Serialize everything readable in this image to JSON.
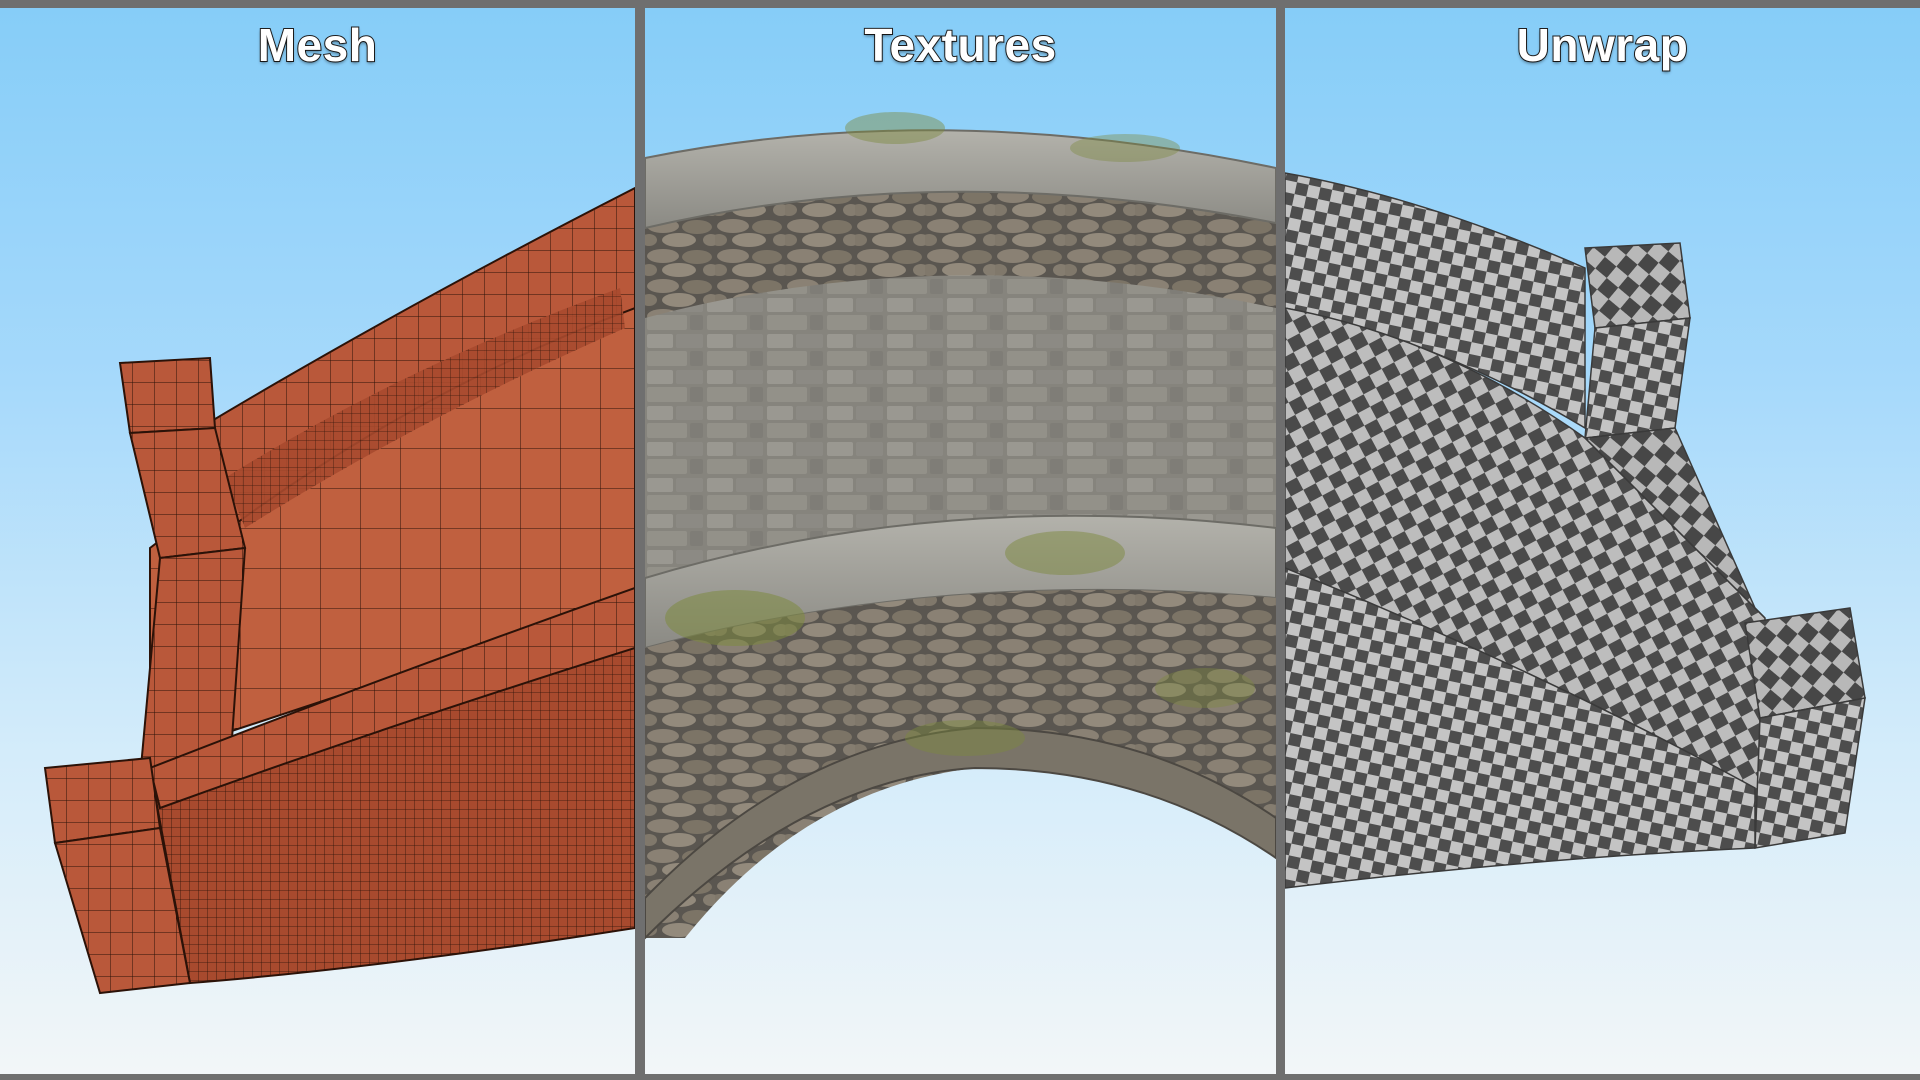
{
  "panels": [
    {
      "id": "mesh",
      "title": "Mesh"
    },
    {
      "id": "textures",
      "title": "Textures"
    },
    {
      "id": "unwrap",
      "title": "Unwrap"
    }
  ],
  "colors": {
    "mesh_fill": "#b9583a",
    "mesh_line": "#2b1208",
    "stone_light": "#a9a8a2",
    "stone_dark": "#6e6c66",
    "moss": "#7d8a3f",
    "checker_light": "#bdbdbd",
    "checker_dark": "#4a4a4a",
    "divider": "#6f6f6f"
  }
}
